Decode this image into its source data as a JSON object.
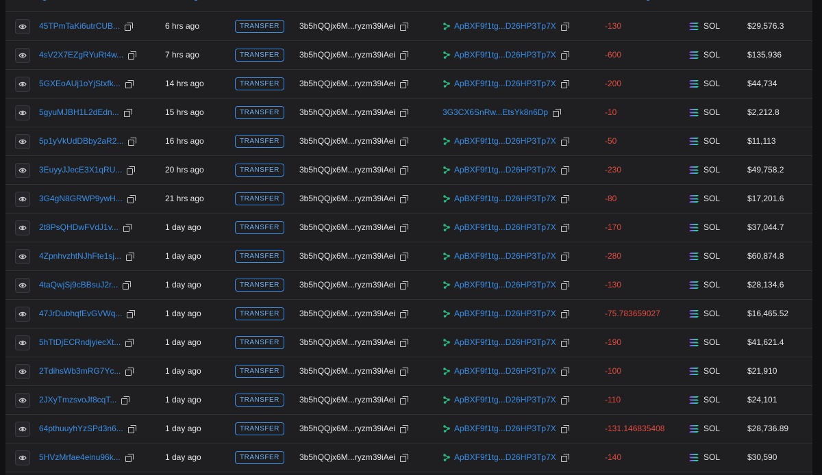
{
  "header": {
    "columns": [
      "",
      "",
      "",
      "",
      "",
      "",
      "",
      "",
      ""
    ]
  },
  "rows": [
    {
      "signature": "45TPmTaKi6utrCUB...",
      "time": "6 hrs ago",
      "type": "TRANSFER",
      "from": "3b5hQQjx6M...ryzm39iAei",
      "to": "ApBXF9f1tg...D26HP3Tp7X",
      "to_program": true,
      "amount": "-130",
      "token": "SOL",
      "value": "$29,576.3"
    },
    {
      "signature": "4sV2X7EZgRYuRt4w...",
      "time": "7 hrs ago",
      "type": "TRANSFER",
      "from": "3b5hQQjx6M...ryzm39iAei",
      "to": "ApBXF9f1tg...D26HP3Tp7X",
      "to_program": true,
      "amount": "-600",
      "token": "SOL",
      "value": "$135,936"
    },
    {
      "signature": "5GXEoAUj1oYjStxfk...",
      "time": "14 hrs ago",
      "type": "TRANSFER",
      "from": "3b5hQQjx6M...ryzm39iAei",
      "to": "ApBXF9f1tg...D26HP3Tp7X",
      "to_program": true,
      "amount": "-200",
      "token": "SOL",
      "value": "$44,734"
    },
    {
      "signature": "5gyuMJBH1L2dEdn...",
      "time": "15 hrs ago",
      "type": "TRANSFER",
      "from": "3b5hQQjx6M...ryzm39iAei",
      "to": "3G3CX6SnRw...EtsYk8n6Dp",
      "to_program": false,
      "amount": "-10",
      "token": "SOL",
      "value": "$2,212.8"
    },
    {
      "signature": "5p1yVkUdDBby2aR2...",
      "time": "16 hrs ago",
      "type": "TRANSFER",
      "from": "3b5hQQjx6M...ryzm39iAei",
      "to": "ApBXF9f1tg...D26HP3Tp7X",
      "to_program": true,
      "amount": "-50",
      "token": "SOL",
      "value": "$11,113"
    },
    {
      "signature": "3EuyyJJecE3X1qRU...",
      "time": "20 hrs ago",
      "type": "TRANSFER",
      "from": "3b5hQQjx6M...ryzm39iAei",
      "to": "ApBXF9f1tg...D26HP3Tp7X",
      "to_program": true,
      "amount": "-230",
      "token": "SOL",
      "value": "$49,758.2"
    },
    {
      "signature": "3G4gN8GRWP9ywH...",
      "time": "21 hrs ago",
      "type": "TRANSFER",
      "from": "3b5hQQjx6M...ryzm39iAei",
      "to": "ApBXF9f1tg...D26HP3Tp7X",
      "to_program": true,
      "amount": "-80",
      "token": "SOL",
      "value": "$17,201.6"
    },
    {
      "signature": "2t8PsQHDwFVdJ1v...",
      "time": "1 day ago",
      "type": "TRANSFER",
      "from": "3b5hQQjx6M...ryzm39iAei",
      "to": "ApBXF9f1tg...D26HP3Tp7X",
      "to_program": true,
      "amount": "-170",
      "token": "SOL",
      "value": "$37,044.7"
    },
    {
      "signature": "4ZpnhvzhtNJhFte1sj...",
      "time": "1 day ago",
      "type": "TRANSFER",
      "from": "3b5hQQjx6M...ryzm39iAei",
      "to": "ApBXF9f1tg...D26HP3Tp7X",
      "to_program": true,
      "amount": "-280",
      "token": "SOL",
      "value": "$60,874.8"
    },
    {
      "signature": "4taQwjSj9cBBsuJ2r...",
      "time": "1 day ago",
      "type": "TRANSFER",
      "from": "3b5hQQjx6M...ryzm39iAei",
      "to": "ApBXF9f1tg...D26HP3Tp7X",
      "to_program": true,
      "amount": "-130",
      "token": "SOL",
      "value": "$28,134.6"
    },
    {
      "signature": "47JrDubhqfEvGVWq...",
      "time": "1 day ago",
      "type": "TRANSFER",
      "from": "3b5hQQjx6M...ryzm39iAei",
      "to": "ApBXF9f1tg...D26HP3Tp7X",
      "to_program": true,
      "amount": "-75.783659027",
      "token": "SOL",
      "value": "$16,465.52"
    },
    {
      "signature": "5hTtDjECRndjyiecXt...",
      "time": "1 day ago",
      "type": "TRANSFER",
      "from": "3b5hQQjx6M...ryzm39iAei",
      "to": "ApBXF9f1tg...D26HP3Tp7X",
      "to_program": true,
      "amount": "-190",
      "token": "SOL",
      "value": "$41,621.4"
    },
    {
      "signature": "2TdihsWb3mRG7Yc...",
      "time": "1 day ago",
      "type": "TRANSFER",
      "from": "3b5hQQjx6M...ryzm39iAei",
      "to": "ApBXF9f1tg...D26HP3Tp7X",
      "to_program": true,
      "amount": "-100",
      "token": "SOL",
      "value": "$21,910"
    },
    {
      "signature": "2JXyTmzsvoJf8cqT...",
      "time": "1 day ago",
      "type": "TRANSFER",
      "from": "3b5hQQjx6M...ryzm39iAei",
      "to": "ApBXF9f1tg...D26HP3Tp7X",
      "to_program": true,
      "amount": "-110",
      "token": "SOL",
      "value": "$24,101"
    },
    {
      "signature": "64pthuuyhYzSPd3n6...",
      "time": "1 day ago",
      "type": "TRANSFER",
      "from": "3b5hQQjx6M...ryzm39iAei",
      "to": "ApBXF9f1tg...D26HP3Tp7X",
      "to_program": true,
      "amount": "-131.146835408",
      "token": "SOL",
      "value": "$28,736.89"
    },
    {
      "signature": "5HVzMrfae4einu96k...",
      "time": "1 day ago",
      "type": "TRANSFER",
      "from": "3b5hQQjx6M...ryzm39iAei",
      "to": "ApBXF9f1tg...D26HP3Tp7X",
      "to_program": true,
      "amount": "-140",
      "token": "SOL",
      "value": "$30,590"
    }
  ],
  "colors": {
    "link": "#3a8ee6",
    "negative": "#e04c3f",
    "program": "#2ebd85",
    "background": "#1f1f22"
  },
  "icons": {
    "view": "eye-icon",
    "copy": "copy-icon",
    "program": "program-icon",
    "token": "solana-logo"
  }
}
